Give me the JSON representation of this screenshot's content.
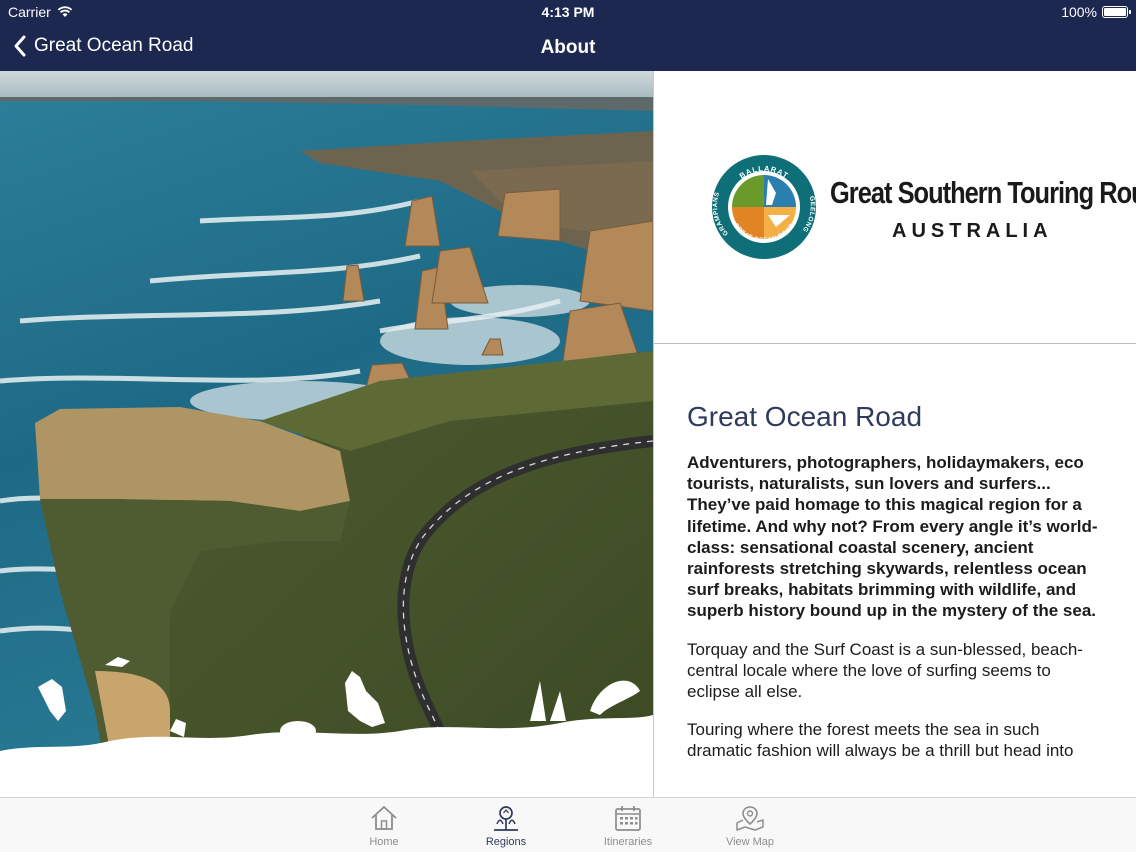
{
  "status_bar": {
    "carrier": "Carrier",
    "time": "4:13 PM",
    "battery": "100%"
  },
  "nav": {
    "back_label": "Great Ocean Road",
    "title": "About"
  },
  "logo": {
    "seal_top": "BALLARAT",
    "seal_left": "GRAMPIANS",
    "seal_right": "GEELONG",
    "seal_bottom": "GREAT OCEAN ROAD",
    "brand_name": "Great Southern Touring Route",
    "brand_country": "AUSTRALIA"
  },
  "content": {
    "title": "Great Ocean Road",
    "lead": "Adventurers, photographers, holidaymakers, eco tourists, naturalists, sun lovers and surfers... They’ve paid homage to this magical region for a lifetime. And why not? From every angle it’s world-class: sensational coastal scenery, ancient rainforests stretching skywards, relentless ocean surf breaks, habitats brimming with wildlife, and superb history bound up in the mystery of the sea.",
    "paragraphs": [
      "Torquay and the Surf Coast is a sun-blessed, beach-central locale where the love of surfing seems to eclipse all else.",
      "Touring where the forest meets the sea in such dramatic fashion will always be a thrill but head into"
    ]
  },
  "tabs": [
    {
      "label": "Home",
      "icon": "home-icon",
      "active": false
    },
    {
      "label": "Regions",
      "icon": "regions-icon",
      "active": true
    },
    {
      "label": "Itineraries",
      "icon": "calendar-icon",
      "active": false
    },
    {
      "label": "View Map",
      "icon": "map-icon",
      "active": false
    }
  ],
  "colors": {
    "nav_bg": "#1d2850",
    "title": "#2f3a5c",
    "tab_inactive": "#8d8d8d"
  }
}
